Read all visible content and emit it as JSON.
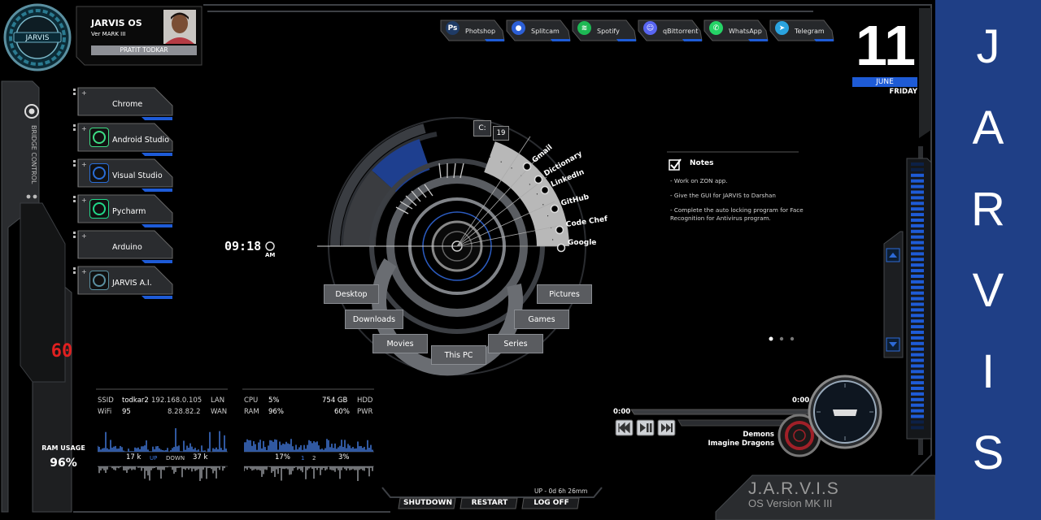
{
  "profile": {
    "title": "JARVIS   OS",
    "version": "Ver MARK III",
    "user": "PRATIT TODKAR",
    "logo_text": "JARVIS"
  },
  "topbar": [
    {
      "label": "Photshop",
      "icon": "photoshop-icon",
      "glyph": "Ps",
      "color": "#1f3b66"
    },
    {
      "label": "Splitcam",
      "icon": "splitcam-icon",
      "glyph": "●",
      "color": "#2c5fd6"
    },
    {
      "label": "Spotify",
      "icon": "spotify-icon",
      "glyph": "≋",
      "color": "#1db954"
    },
    {
      "label": "qBittorrent",
      "icon": "discord-icon",
      "glyph": "☺",
      "color": "#5865f2"
    },
    {
      "label": "WhatsApp",
      "icon": "whatsapp-icon",
      "glyph": "✆",
      "color": "#25d366"
    },
    {
      "label": "Telegram",
      "icon": "telegram-icon",
      "glyph": "➤",
      "color": "#2aa3df"
    }
  ],
  "date": {
    "day": "11",
    "month": "JUNE",
    "weekday": "FRIDAY"
  },
  "left_apps": [
    {
      "label": "Chrome",
      "icon": "chrome-icon"
    },
    {
      "label": "Android Studio",
      "icon": "android-studio-icon"
    },
    {
      "label": "Visual Studio",
      "icon": "visual-studio-icon"
    },
    {
      "label": "Pycharm",
      "icon": "pycharm-icon"
    },
    {
      "label": "Arduino",
      "icon": "arduino-icon"
    },
    {
      "label": "JARVIS A.I.",
      "icon": "jarvis-ai-icon"
    }
  ],
  "bridge_control": "BRIDGE CONTROL",
  "left_gauge": {
    "value": "60",
    "ram_label": "RAM USAGE",
    "ram_value": "96%"
  },
  "clock": {
    "time": "09:18",
    "ampm": "AM"
  },
  "drive": {
    "label": "C:",
    "value": "19"
  },
  "web_links": [
    "Gmail",
    "Dictionary",
    "LinkedIn",
    "GitHub",
    "Code Chef",
    "Google"
  ],
  "folders": [
    "Desktop",
    "Downloads",
    "Movies",
    "This PC",
    "Series",
    "Games",
    "Pictures"
  ],
  "notes": {
    "title": "Notes",
    "items": [
      "- Work on ZON app.",
      "- Give the GUI for JARVIS to Darshan",
      "- Complete the auto locking program for Face Recognition for Antivirus program."
    ]
  },
  "network": {
    "ssid_label": "SSID",
    "ssid": "todkar2",
    "ip_lan": "192.168.0.105",
    "lan": "LAN",
    "wifi_label": "WiFi",
    "wifi": "95",
    "ip_wan": "8.28.82.2",
    "wan": "WAN",
    "up_value": "17 k",
    "up": "UP",
    "down": "DOWN",
    "down_value": "37 k"
  },
  "system": {
    "cpu_label": "CPU",
    "cpu": "5%",
    "hdd_value": "754 GB",
    "hdd": "HDD",
    "ram_label": "RAM",
    "ram": "96%",
    "pwr_value": "60%",
    "pwr": "PWR",
    "core1_value": "17%",
    "core1": "1",
    "core2": "2",
    "core2_value": "3%"
  },
  "uptime": "UP - 0d 6h 26mm",
  "power": [
    "SHUTDOWN",
    "RESTART",
    "LOG OFF"
  ],
  "brand": {
    "name": "J.A.R.V.I.S",
    "version": "OS Version MK III"
  },
  "player": {
    "time_start": "0:00",
    "time_end": "0:00",
    "song": "Demons",
    "artist": "Imagine Dragons",
    "progress": 0
  },
  "sidebar_letters": [
    "J",
    "A",
    "R",
    "V",
    "I",
    "S"
  ],
  "colors": {
    "accent": "#1e5bd6",
    "sidebar": "#1f3f86",
    "red": "#e02020"
  }
}
